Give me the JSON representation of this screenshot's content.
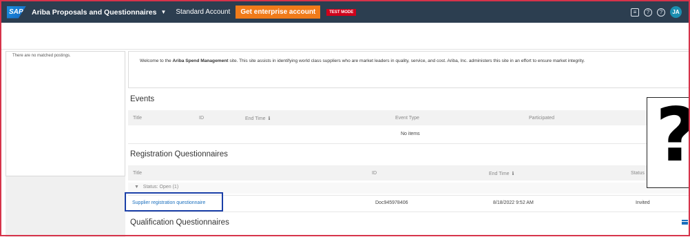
{
  "topbar": {
    "logo": "SAP",
    "app_title": "Ariba Proposals and Questionnaires",
    "account_label": "Standard Account",
    "enterprise_button": "Get enterprise account",
    "test_badge": "TEST MODE",
    "avatar_initials": "JA",
    "background_color": "#2c3e50",
    "accent_button_color": "#f07b1a"
  },
  "sidebar": {
    "postings_message": "There are no matched postings."
  },
  "welcome": {
    "prefix": "Welcome to the ",
    "site_name": "Ariba Spend Management",
    "suffix": " site.  This site assists in identifying world class suppliers who are market leaders in quality, service, and cost. Ariba, Inc. administers this site in an effort to ensure market integrity."
  },
  "events": {
    "title": "Events",
    "columns": [
      "Title",
      "ID",
      "End Time",
      "Event Type",
      "Participated"
    ],
    "empty_message": "No items"
  },
  "registration": {
    "title": "Registration Questionnaires",
    "columns": [
      "Title",
      "ID",
      "End Time",
      "Status"
    ],
    "group_label": "Status: Open",
    "group_count": "(1)",
    "rows": [
      {
        "title": "Supplier registration questionnaire",
        "id": "Doc945978406",
        "end_time": "8/18/2022 9:52 AM",
        "status": "Invited"
      }
    ]
  },
  "qualification": {
    "title": "Qualification Questionnaires"
  },
  "overlay": {
    "symbol": "?"
  }
}
